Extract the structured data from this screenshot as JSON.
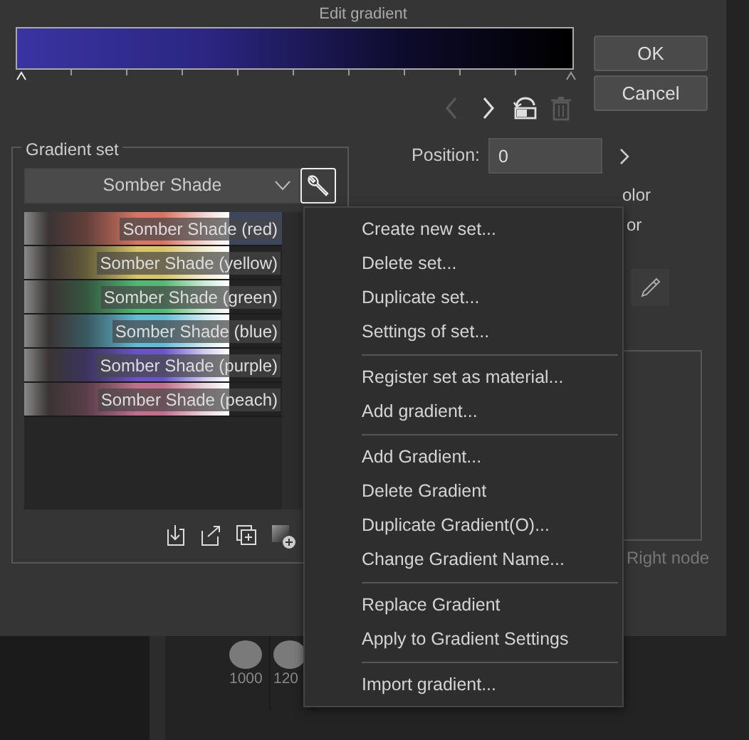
{
  "window": {
    "title": "Edit gradient"
  },
  "buttons": [
    {
      "label": "OK"
    },
    {
      "label": "Cancel"
    }
  ],
  "node_tools": [
    {
      "kind": "prev",
      "disabled": true
    },
    {
      "kind": "next",
      "disabled": false
    },
    {
      "kind": "flip",
      "disabled": false
    },
    {
      "kind": "delete",
      "disabled": true
    }
  ],
  "gradient_set": {
    "label": "Gradient set",
    "selected_set": "Somber Shade",
    "gradients": [
      {
        "name": "Somber Shade (red)",
        "color": "#d87464",
        "selected": true
      },
      {
        "name": "Somber Shade (yellow)",
        "color": "#d8c468",
        "selected": false
      },
      {
        "name": "Somber Shade (green)",
        "color": "#52b874",
        "selected": false
      },
      {
        "name": "Somber Shade (blue)",
        "color": "#62bcd4",
        "selected": false
      },
      {
        "name": "Somber Shade (purple)",
        "color": "#6a54c8",
        "selected": false
      },
      {
        "name": "Somber Shade (peach)",
        "color": "#c0708e",
        "selected": false
      }
    ]
  },
  "properties": {
    "position": {
      "label": "Position:",
      "value": "0"
    },
    "partial_labels": [
      "olor",
      "or"
    ],
    "node_caption": "Right node"
  },
  "context_menu": {
    "groups": [
      [
        "Create new set...",
        "Delete set...",
        "Duplicate set...",
        "Settings of set..."
      ],
      [
        "Register set as material...",
        "Add gradient..."
      ],
      [
        "Add Gradient...",
        "Delete Gradient",
        "Duplicate Gradient(O)...",
        "Change Gradient Name..."
      ],
      [
        "Replace Gradient",
        "Apply to Gradient Settings"
      ],
      [
        "Import gradient..."
      ]
    ]
  },
  "brush_sizes": [
    "1000",
    "120"
  ]
}
